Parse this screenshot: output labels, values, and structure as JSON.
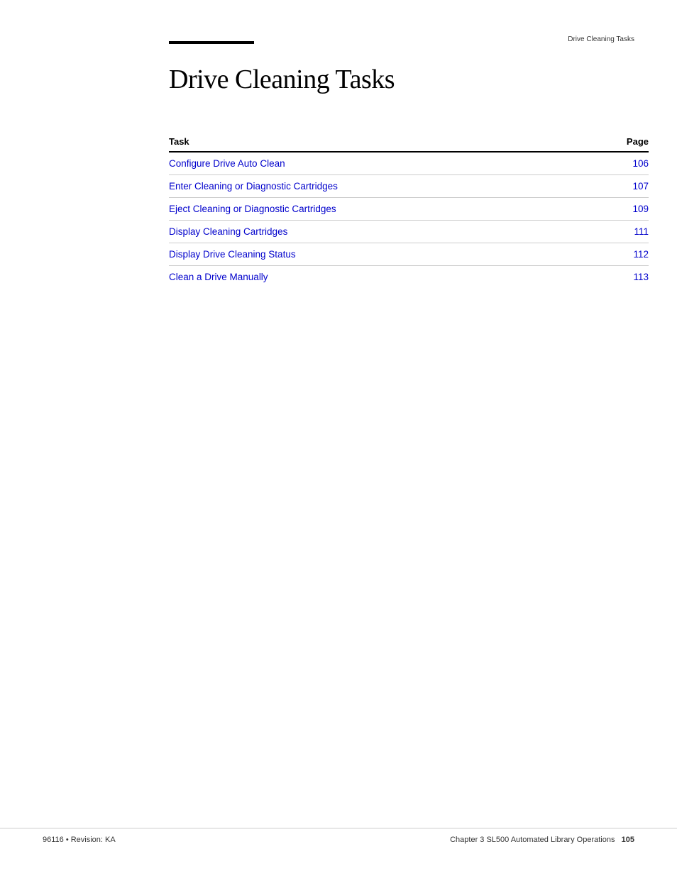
{
  "header": {
    "right_text": "Drive Cleaning Tasks",
    "rule_visible": true
  },
  "page": {
    "title": "Drive Cleaning Tasks"
  },
  "table": {
    "col_task_label": "Task",
    "col_page_label": "Page",
    "rows": [
      {
        "label": "Configure Drive Auto Clean",
        "page": "106"
      },
      {
        "label": "Enter Cleaning or Diagnostic Cartridges",
        "page": "107"
      },
      {
        "label": "Eject Cleaning or Diagnostic Cartridges",
        "page": "109"
      },
      {
        "label": "Display Cleaning Cartridges",
        "page": "111"
      },
      {
        "label": "Display Drive Cleaning Status",
        "page": "112"
      },
      {
        "label": "Clean a Drive Manually",
        "page": "113"
      }
    ]
  },
  "footer": {
    "left": "96116 • Revision: KA",
    "right_prefix": "Chapter 3 SL500 Automated Library Operations",
    "page_number": "105"
  }
}
